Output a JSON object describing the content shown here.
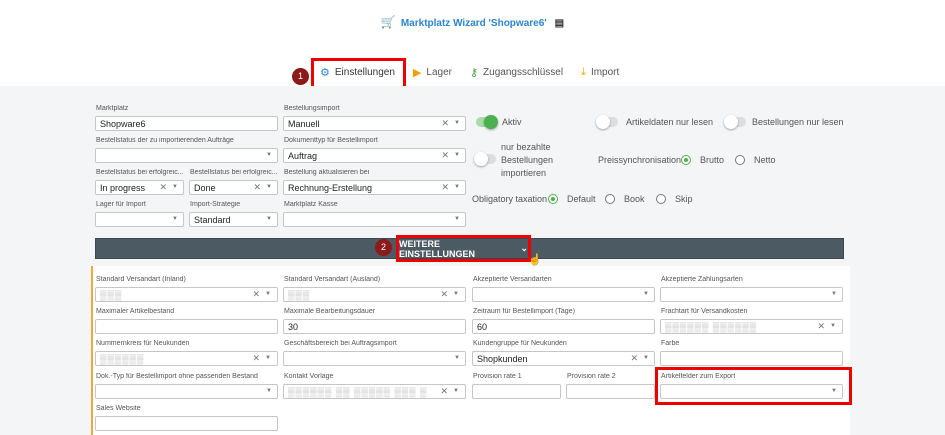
{
  "header": {
    "title": "Marktplatz Wizard 'Shopware6'"
  },
  "tabs": [
    {
      "label": "Einstellungen"
    },
    {
      "label": "Lager"
    },
    {
      "label": "Zugangsschlüssel"
    },
    {
      "label": "Import"
    }
  ],
  "annotations": {
    "badge1": "1",
    "badge2": "2"
  },
  "form": {
    "marktplatz": {
      "label": "Marktplatz",
      "value": "Shopware6"
    },
    "bestellungsimport": {
      "label": "Bestellungsimport",
      "value": "Manuell"
    },
    "bestellstatus_import": {
      "label": "Bestellstatus der zu importierenden Aufträge",
      "value": ""
    },
    "dokumenttyp": {
      "label": "Dokumenttyp für Bestellimport",
      "value": "Auftrag"
    },
    "status_erfolg1": {
      "label": "Bestellstatus bei erfolgreic...",
      "value": "In progress"
    },
    "status_erfolg2": {
      "label": "Bestellstatus bei erfolgreic...",
      "value": "Done"
    },
    "bestellung_aktualisieren": {
      "label": "Bestellung aktualisieren bei",
      "value": "Rechnung-Erstellung"
    },
    "lager_import": {
      "label": "Lager für Import",
      "value": ""
    },
    "import_strategie": {
      "label": "Import-Strategie",
      "value": "Standard"
    },
    "marktplatz_kasse": {
      "label": "Marktplatz Kasse",
      "value": ""
    }
  },
  "toggles": {
    "aktiv": "Aktiv",
    "artikeldaten": "Artikeldaten nur lesen",
    "bestellungen_lesen": "Bestellungen nur lesen",
    "nur_bezahlte_1": "nur bezahlte",
    "nur_bezahlte_2": "Bestellungen",
    "nur_bezahlte_3": "importieren"
  },
  "preis": {
    "label": "Preissynchronisation",
    "opt1": "Brutto",
    "opt2": "Netto"
  },
  "taxation": {
    "label": "Obligatory taxation",
    "opt1": "Default",
    "opt2": "Book",
    "opt3": "Skip"
  },
  "more_button": {
    "label": "WEITERE EINSTELLUNGEN",
    "icon": "chevron-down-icon"
  },
  "more": {
    "versand_inland": {
      "label": "Standard Versandart (Inland)",
      "value": "▒▒▒"
    },
    "versand_ausland": {
      "label": "Standard Versandart (Ausland)",
      "value": "▒▒▒"
    },
    "akz_versandarten": {
      "label": "Akzeptierte Versandarten",
      "value": ""
    },
    "akz_zahlungsarten": {
      "label": "Akzeptierte Zahlungsarten",
      "value": ""
    },
    "max_artikelbestand": {
      "label": "Maximaler Artikelbestand",
      "value": ""
    },
    "max_bearbeitung": {
      "label": "Maximale Bearbeitungsdauer",
      "value": "30"
    },
    "zeitraum": {
      "label": "Zeitraum für Bestellimport (Tage)",
      "value": "60"
    },
    "frachtart": {
      "label": "Frachtart für Versandkosten",
      "value": "▒▒▒▒▒▒ ▒▒▒▒▒▒"
    },
    "nummernkreis": {
      "label": "Nummernkreis für Neukunden",
      "value": "▒▒▒▒▒▒"
    },
    "geschaeftsbereich": {
      "label": "Geschäftsbereich bei Auftragsimport",
      "value": ""
    },
    "kundengruppe": {
      "label": "Kundengruppe für Neukunden",
      "value": "Shopkunden"
    },
    "farbe": {
      "label": "Farbe",
      "value": ""
    },
    "dok_typ": {
      "label": "Dok.-Typ für Bestellimport ohne passenden Bestand",
      "value": ""
    },
    "kontakt_vorlage": {
      "label": "Kontakt Vorlage",
      "value": "▒▒▒▒▒▒ ▒▒ ▒▒▒▒▒ ▒▒▒ ▒"
    },
    "provision1": {
      "label": "Provision rate 1",
      "value": ""
    },
    "provision2": {
      "label": "Provision rate 2",
      "value": ""
    },
    "artikelfelder": {
      "label": "Artikelfelder zum Export",
      "value": ""
    },
    "sales_website": {
      "label": "Sales Website",
      "value": ""
    }
  }
}
